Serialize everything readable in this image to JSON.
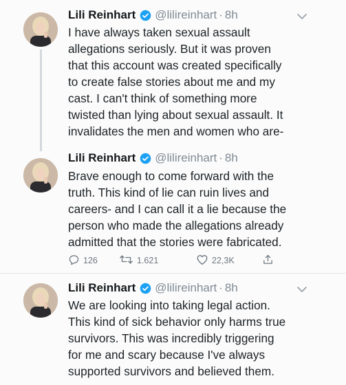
{
  "tweets": [
    {
      "name": "Lili Reinhart",
      "handle": "@lilireinhart",
      "sep": "·",
      "time": "8h",
      "text": "I have always taken sexual assault\nallegations seriously. But it was proven\nthat this account was created specifically\nto create false stories about me and my\ncast.  I can't think of something more\ntwisted than lying about sexual assault. It\ninvalidates the men and women who are-"
    },
    {
      "name": "Lili Reinhart",
      "handle": "@lilireinhart",
      "sep": "·",
      "time": "8h",
      "text": "Brave enough to come forward with the\ntruth. This kind of lie can ruin lives and\ncareers- and I can call it a lie because the\nperson who made the allegations already\nadmitted that the stories were fabricated.",
      "actions": {
        "replies": "126",
        "retweets": "1.621",
        "likes": "22,3K"
      }
    },
    {
      "name": "Lili Reinhart",
      "handle": "@lilireinhart",
      "sep": "·",
      "time": "8h",
      "text": "We are looking into taking legal action.\nThis kind of sick behavior only harms true\nsurvivors. This was incredibly triggering\nfor me and scary because I've always\nsupported survivors and believed them."
    }
  ],
  "icons": {
    "verified": "verified-badge-icon",
    "caret": "chevron-down-icon",
    "reply": "reply-icon",
    "retweet": "retweet-icon",
    "like": "heart-icon",
    "share": "share-icon"
  },
  "colors": {
    "verified": "#1da1f2",
    "muted": "#7f8a94",
    "text": "#1d2226"
  }
}
